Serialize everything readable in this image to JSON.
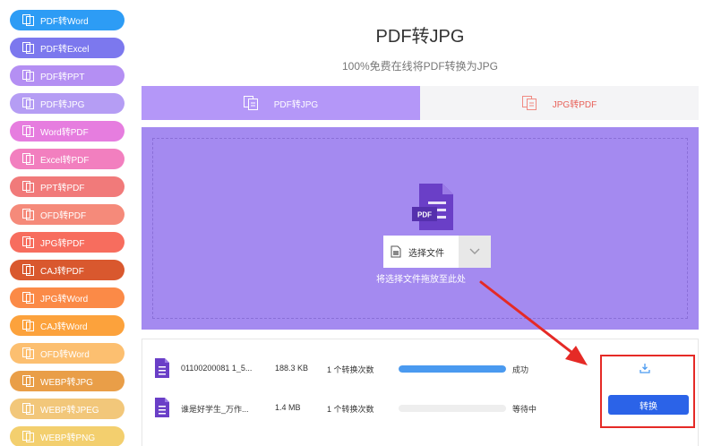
{
  "sidebar": {
    "items": [
      {
        "label": "PDF转Word",
        "color": "#2d9cf5"
      },
      {
        "label": "PDF转Excel",
        "color": "#7c78ee"
      },
      {
        "label": "PDF转PPT",
        "color": "#b48ff3"
      },
      {
        "label": "PDF转JPG",
        "color": "#b59df4"
      },
      {
        "label": "Word转PDF",
        "color": "#e67ddf"
      },
      {
        "label": "Excel转PDF",
        "color": "#f27fbf"
      },
      {
        "label": "PPT转PDF",
        "color": "#f17a7a"
      },
      {
        "label": "OFD转PDF",
        "color": "#f58a7a"
      },
      {
        "label": "JPG转PDF",
        "color": "#f76d5e"
      },
      {
        "label": "CAJ转PDF",
        "color": "#d9582e"
      },
      {
        "label": "JPG转Word",
        "color": "#fb8a47"
      },
      {
        "label": "CAJ转Word",
        "color": "#fca23c"
      },
      {
        "label": "OFD转Word",
        "color": "#fcbf70"
      },
      {
        "label": "WEBP转JPG",
        "color": "#e99e48"
      },
      {
        "label": "WEBP转JPEG",
        "color": "#f2c77a"
      },
      {
        "label": "WEBP转PNG",
        "color": "#f3cf6e"
      }
    ]
  },
  "header": {
    "title": "PDF转JPG",
    "subtitle": "100%免费在线将PDF转换为JPG"
  },
  "tabs": [
    {
      "label": "PDF转JPG",
      "active": true
    },
    {
      "label": "JPG转PDF",
      "active": false
    }
  ],
  "upload": {
    "doc_label": "PDF",
    "choose_label": "选择文件",
    "drop_hint": "将选择文件拖放至此处"
  },
  "files": [
    {
      "name": "01100200081 1_5...",
      "size": "188.3 KB",
      "count": "1 个转换次数",
      "progress": 1.0,
      "status": "成功"
    },
    {
      "name": "谁是好学生_万作...",
      "size": "1.4 MB",
      "count": "1 个转换次数",
      "progress": 0.0,
      "status": "等待中"
    }
  ],
  "actions": {
    "convert_label": "转换"
  },
  "colors": {
    "accent": "#a48af0",
    "tab_active": "#b497f8",
    "progress": "#4a9af0",
    "convert": "#2b63e8",
    "annotation": "#e52a26"
  }
}
